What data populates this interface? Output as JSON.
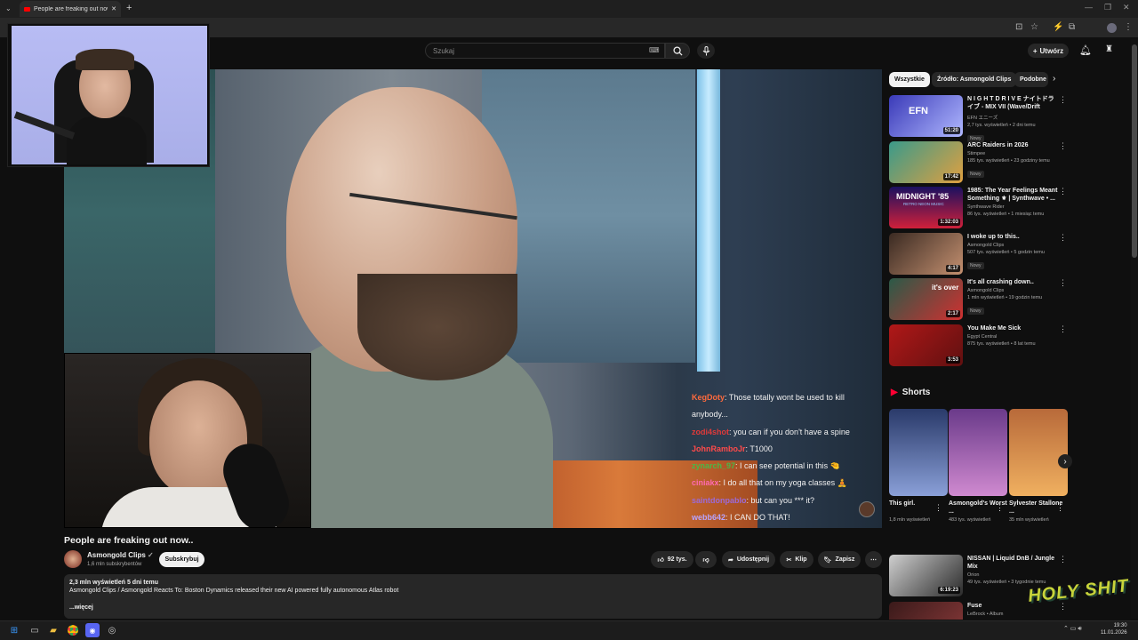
{
  "browser": {
    "tab_title": "People are freaking out now..."
  },
  "header": {
    "search_placeholder": "Szukaj",
    "create_label": "Utwórz"
  },
  "chat": [
    {
      "user": "KegDoty",
      "color": "#ff6a3d",
      "msg": "Those totally wont be used to kill"
    },
    {
      "user": "",
      "color": "#ffffff",
      "msg": "anybody..."
    },
    {
      "user": "zodi4shot",
      "color": "#e03a3a",
      "msg": "you can if you don't have a spine"
    },
    {
      "user": "JohnRamboJr",
      "color": "#ff4a4a",
      "msg": "T1000"
    },
    {
      "user": "zynarch_97",
      "color": "#4ab848",
      "msg": "I can see potential in this"
    },
    {
      "user": "ciniakx",
      "color": "#ff6ab0",
      "msg": "I do all that on my yoga classes"
    },
    {
      "user": "saintdonpablo",
      "color": "#9b6ad8",
      "msg": "but can you *** it?"
    },
    {
      "user": "webb642",
      "color": "#b7a4ff",
      "msg": "I CAN DO THAT!"
    }
  ],
  "video": {
    "title": "People are freaking out now..",
    "channel": "Asmongold Clips",
    "subscribers": "1,6 mln subskrybentów",
    "subscribe_label": "Subskrybuj",
    "likes": "92 tys.",
    "share_label": "Udostępnij",
    "clip_label": "Klip",
    "save_label": "Zapisz",
    "views_line": "2,3 mln wyświetleń  5 dni temu",
    "description": "Asmongold Clips / Asmongold Reacts To: Boston Dynamics released their new AI powered fully autonomous Atlas robot",
    "more_label": "...więcej"
  },
  "chips": [
    "Wszystkie",
    "Źródło: Asmongold Clips",
    "Podobne"
  ],
  "sidebar": [
    {
      "title": "N I G H T D R I V E ナイトドライブ - MIX VII (Wave/Drift Phonk...",
      "channel": "EFN エニーズ",
      "stats": "2,7 tys. wyświetleń • 2 dni temu",
      "badge": "Nowy",
      "duration": "51:20",
      "thumb": "#3a3ab8",
      "thumb2": "#b0b8ff"
    },
    {
      "title": "ARC Raiders in 2026",
      "channel": "Stimpee",
      "stats": "185 tys. wyświetleń • 23 godziny temu",
      "badge": "Nowy",
      "duration": "17:42",
      "thumb": "#3a9a8a",
      "thumb2": "#e0a040"
    },
    {
      "title": "1985: The Year Feelings Meant Something ⚜ | Synthwave • ...",
      "channel": "Synthwave Rider",
      "stats": "86 tys. wyświetleń • 1 miesiąc temu",
      "badge": "",
      "duration": "1:32:03",
      "thumb": "#1a1060",
      "thumb2": "#d0203a"
    },
    {
      "title": "I woke up to this..",
      "channel": "Asmongold Clips",
      "stats": "507 tys. wyświetleń • 5 godzin temu",
      "badge": "Nowy",
      "duration": "4:17",
      "thumb": "#3a2a22",
      "thumb2": "#c49070"
    },
    {
      "title": "It's all crashing down..",
      "channel": "Asmongold Clips",
      "stats": "1 mln wyświetleń • 19 godzin temu",
      "badge": "Nowy",
      "duration": "2:17",
      "thumb": "#2a5a48",
      "thumb2": "#d03030"
    },
    {
      "title": "You Make Me Sick",
      "channel": "Egypt Central",
      "stats": "875 tys. wyświetleń • 8 lat temu",
      "badge": "",
      "duration": "3:53",
      "thumb": "#b01818",
      "thumb2": "#601010"
    }
  ],
  "sidebar_overlay_text": {
    "efn": "EFN",
    "midnight": "MIDNIGHT '85",
    "retro": "RETRO NEON MUSIC",
    "its_over": "it's over"
  },
  "shorts_header": "Shorts",
  "shorts": [
    {
      "title": "This girl.",
      "views": "1,8 mln wyświetleń",
      "thumb": "#2a3a6a",
      "thumb2": "#8aa0d8"
    },
    {
      "title": "Asmongold's Worst ...",
      "views": "483 tys. wyświetleń",
      "thumb": "#6a3a8a",
      "thumb2": "#d08ad0"
    },
    {
      "title": "Sylvester Stallone ...",
      "views": "35 mln wyświetleń",
      "thumb": "#b86a3a",
      "thumb2": "#f0b060"
    }
  ],
  "sidebar_extra": [
    {
      "title": "NISSAN | Liquid DnB / Jungle Mix",
      "channel": "Orion",
      "stats": "49 tys. wyświetleń • 3 tygodnie temu",
      "duration": "6:19:23",
      "thumb": "#cfcfcf",
      "thumb2": "#2a2a2a"
    },
    {
      "title": "Fuse",
      "channel": "LeBrock • Album",
      "stats": "",
      "duration": "",
      "thumb": "#3a1a1a",
      "thumb2": "#8a3a3a"
    }
  ],
  "watermark": "HOLY SHIT",
  "clock": {
    "time": "19:30",
    "date": "11.01.2026"
  }
}
